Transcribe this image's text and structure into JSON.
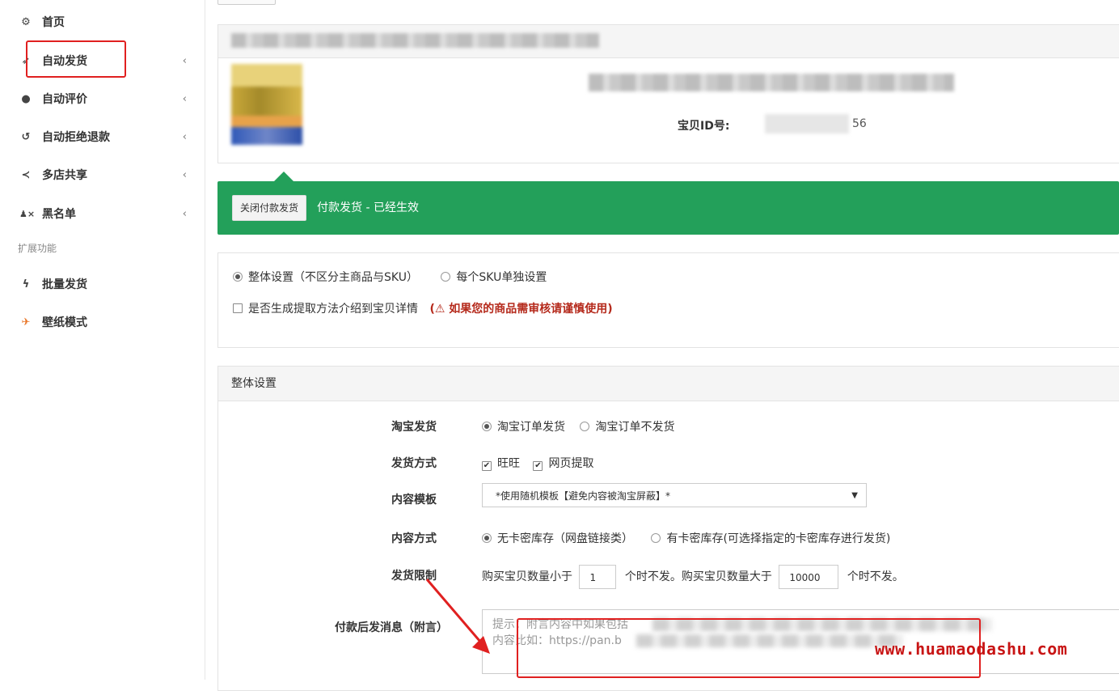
{
  "sidebar": {
    "items": [
      {
        "label": "首页",
        "icon": "dashboard-icon",
        "glyph": "⚙",
        "chevron": ""
      },
      {
        "label": "自动发货",
        "icon": "send-icon",
        "glyph": "➶",
        "chevron": "‹"
      },
      {
        "label": "自动评价",
        "icon": "comment-icon",
        "glyph": "●",
        "chevron": "‹"
      },
      {
        "label": "自动拒绝退款",
        "icon": "history-icon",
        "glyph": "↺",
        "chevron": "‹"
      },
      {
        "label": "多店共享",
        "icon": "share-icon",
        "glyph": "≺",
        "chevron": "‹"
      },
      {
        "label": "黑名单",
        "icon": "user-block-icon",
        "glyph": "♟×",
        "chevron": "‹"
      }
    ],
    "section_label": "扩展功能",
    "ext_items": [
      {
        "label": "批量发货",
        "icon": "bolt-icon",
        "glyph": "ϟ"
      },
      {
        "label": "壁纸模式",
        "icon": "rocket-icon",
        "glyph": "✈"
      }
    ]
  },
  "product": {
    "id_label": "宝贝ID号:",
    "id_value_visible": "56"
  },
  "status_bar": {
    "button": "关闭付款发货",
    "status": "付款发货 - 已经生效",
    "color": "#23a05a"
  },
  "options": {
    "radio_whole": "整体设置（不区分主商品与SKU）",
    "radio_sku": "每个SKU单独设置",
    "checkbox_intro": "是否生成提取方法介绍到宝贝详情",
    "warning": "(⚠ 如果您的商品需审核请谨慎使用)"
  },
  "settings": {
    "title": "整体设置",
    "taobao_ship_label": "淘宝发货",
    "taobao_ship_opt1": "淘宝订单发货",
    "taobao_ship_opt2": "淘宝订单不发货",
    "method_label": "发货方式",
    "method_opt1": "旺旺",
    "method_opt2": "网页提取",
    "template_label": "内容模板",
    "template_value": "*使用随机模板【避免内容被淘宝屏蔽】*",
    "content_label": "内容方式",
    "content_opt1": "无卡密库存（网盘链接类）",
    "content_opt2": "有卡密库存(可选择指定的卡密库存进行发货)",
    "limit_label": "发货限制",
    "limit_text1": "购买宝贝数量小于",
    "limit_min": "1",
    "limit_text2": "个时不发。购买宝贝数量大于",
    "limit_max": "10000",
    "limit_text3": "个时不发。",
    "message_label": "付款后发消息（附言）",
    "message_placeholder_1": "提示：附言内容中如果包括",
    "message_placeholder_2": "内容比如：https://pan.b"
  },
  "watermark": "www.huamaodashu.com"
}
